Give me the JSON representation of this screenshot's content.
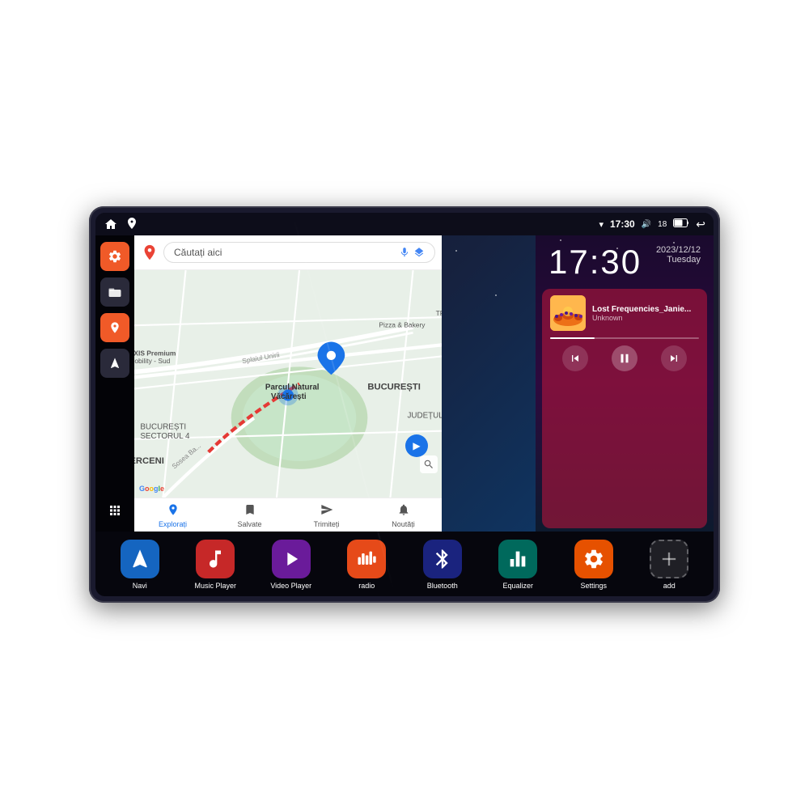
{
  "device": {
    "status_bar": {
      "wifi_icon": "▾",
      "time": "17:30",
      "volume_icon": "🔊",
      "battery_level": "18",
      "battery_icon": "🔋",
      "back_icon": "↩"
    },
    "clock": {
      "time": "17:30",
      "year_date": "2023/12/12",
      "day": "Tuesday"
    },
    "music": {
      "title": "Lost Frequencies_Janie...",
      "artist": "Unknown"
    },
    "maps": {
      "search_placeholder": "Căutați aici",
      "labels": [
        "AXIS Premium Mobility - Sud",
        "Pizza & Bakery",
        "TRAPEZULUI",
        "Parcul Natural Văcărești",
        "BUCUREȘTI",
        "SECTORUL 4",
        "BERCENI",
        "JUDEȚUL ILFOV"
      ],
      "tabs": [
        "Explorați",
        "Salvate",
        "Trimiteți",
        "Noutăți"
      ]
    },
    "apps": [
      {
        "label": "Navi",
        "icon": "navi",
        "color": "blue"
      },
      {
        "label": "Music Player",
        "icon": "music",
        "color": "red"
      },
      {
        "label": "Video Player",
        "icon": "video",
        "color": "purple"
      },
      {
        "label": "radio",
        "icon": "radio",
        "color": "orange-red"
      },
      {
        "label": "Bluetooth",
        "icon": "bluetooth",
        "color": "bluetooth-blue"
      },
      {
        "label": "Equalizer",
        "icon": "equalizer",
        "color": "teal"
      },
      {
        "label": "Settings",
        "icon": "settings",
        "color": "orange"
      },
      {
        "label": "add",
        "icon": "add",
        "color": "gray"
      }
    ],
    "sidebar": [
      {
        "icon": "settings",
        "color": "orange"
      },
      {
        "icon": "folder",
        "color": "dark"
      },
      {
        "icon": "map",
        "color": "orange"
      },
      {
        "icon": "nav",
        "color": "dark"
      },
      {
        "icon": "grid",
        "color": "transparent"
      }
    ]
  }
}
